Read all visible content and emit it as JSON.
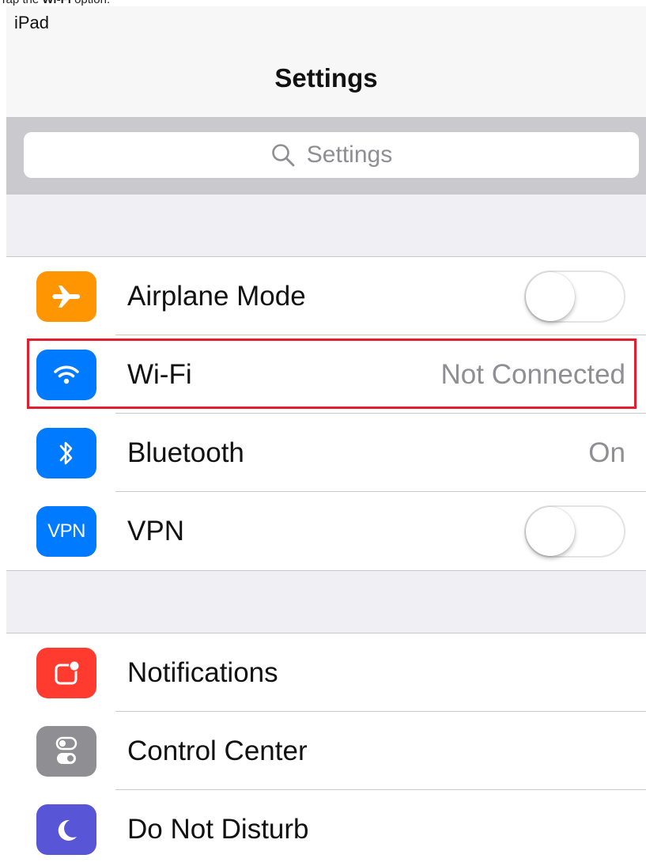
{
  "caption": {
    "prefix": "Tap the ",
    "bold": "Wi-Fi",
    "suffix": " option."
  },
  "status_bar": {
    "device": "iPad"
  },
  "nav": {
    "title": "Settings"
  },
  "search": {
    "placeholder": "Settings",
    "icon": "search-icon"
  },
  "group1": [
    {
      "label": "Airplane Mode",
      "icon": "airplane-icon",
      "icon_color": "#ff9500",
      "control": "toggle",
      "on": false
    },
    {
      "label": "Wi-Fi",
      "icon": "wifi-icon",
      "icon_color": "#007aff",
      "value": "Not Connected",
      "highlighted": true
    },
    {
      "label": "Bluetooth",
      "icon": "bluetooth-icon",
      "icon_color": "#007aff",
      "value": "On"
    },
    {
      "label": "VPN",
      "icon": "vpn-icon",
      "icon_text": "VPN",
      "icon_color": "#007aff",
      "control": "toggle",
      "on": false
    }
  ],
  "group2": [
    {
      "label": "Notifications",
      "icon": "notifications-icon",
      "icon_color": "#ff3b30"
    },
    {
      "label": "Control Center",
      "icon": "control-center-icon",
      "icon_color": "#8e8e93"
    },
    {
      "label": "Do Not Disturb",
      "icon": "moon-icon",
      "icon_color": "#5856d6"
    }
  ],
  "colors": {
    "highlight": "#e0202e",
    "background": "#efeff4",
    "search_bar": "#c9c9ce"
  }
}
